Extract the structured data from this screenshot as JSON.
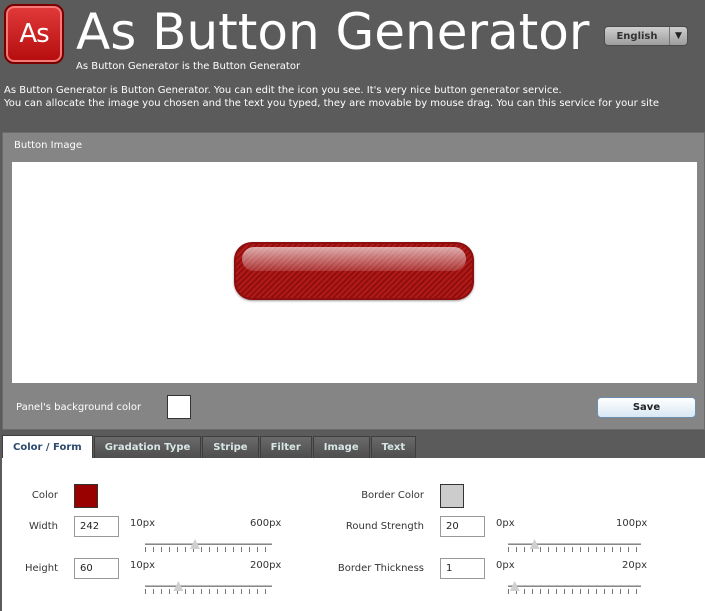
{
  "header": {
    "logo_text": "As",
    "title": "As Button Generator",
    "subtitle": "As Button Generator is the Button Generator",
    "language": "English"
  },
  "description": {
    "line1": "As Button Generator is Button Generator. You can edit the icon you see. It's very nice button generator service.",
    "line2": "You can allocate the image you chosen and the text you typed, they are movable by mouse drag. You can this service for your site"
  },
  "image_panel": {
    "title": "Button Image",
    "bg_color_label": "Panel's background color",
    "bg_color": "#ffffff",
    "save_label": "Save",
    "button_color": "#9b1414"
  },
  "tabs": [
    {
      "label": "Color / Form",
      "active": true
    },
    {
      "label": "Gradation Type",
      "active": false
    },
    {
      "label": "Stripe",
      "active": false
    },
    {
      "label": "Filter",
      "active": false
    },
    {
      "label": "Image",
      "active": false
    },
    {
      "label": "Text",
      "active": false
    }
  ],
  "form": {
    "color_label": "Color",
    "color_value": "#990000",
    "width_label": "Width",
    "width_value": "242",
    "width_min": "10px",
    "width_max": "600px",
    "width_fraction": 0.394,
    "height_label": "Height",
    "height_value": "60",
    "height_min": "10px",
    "height_max": "200px",
    "height_fraction": 0.263,
    "border_color_label": "Border Color",
    "border_color_value": "#cccccc",
    "round_label": "Round Strength",
    "round_value": "20",
    "round_min": "0px",
    "round_max": "100px",
    "round_fraction": 0.2,
    "border_thickness_label": "Border Thickness",
    "border_thickness_value": "1",
    "border_thickness_min": "0px",
    "border_thickness_max": "20px",
    "border_thickness_fraction": 0.05
  }
}
